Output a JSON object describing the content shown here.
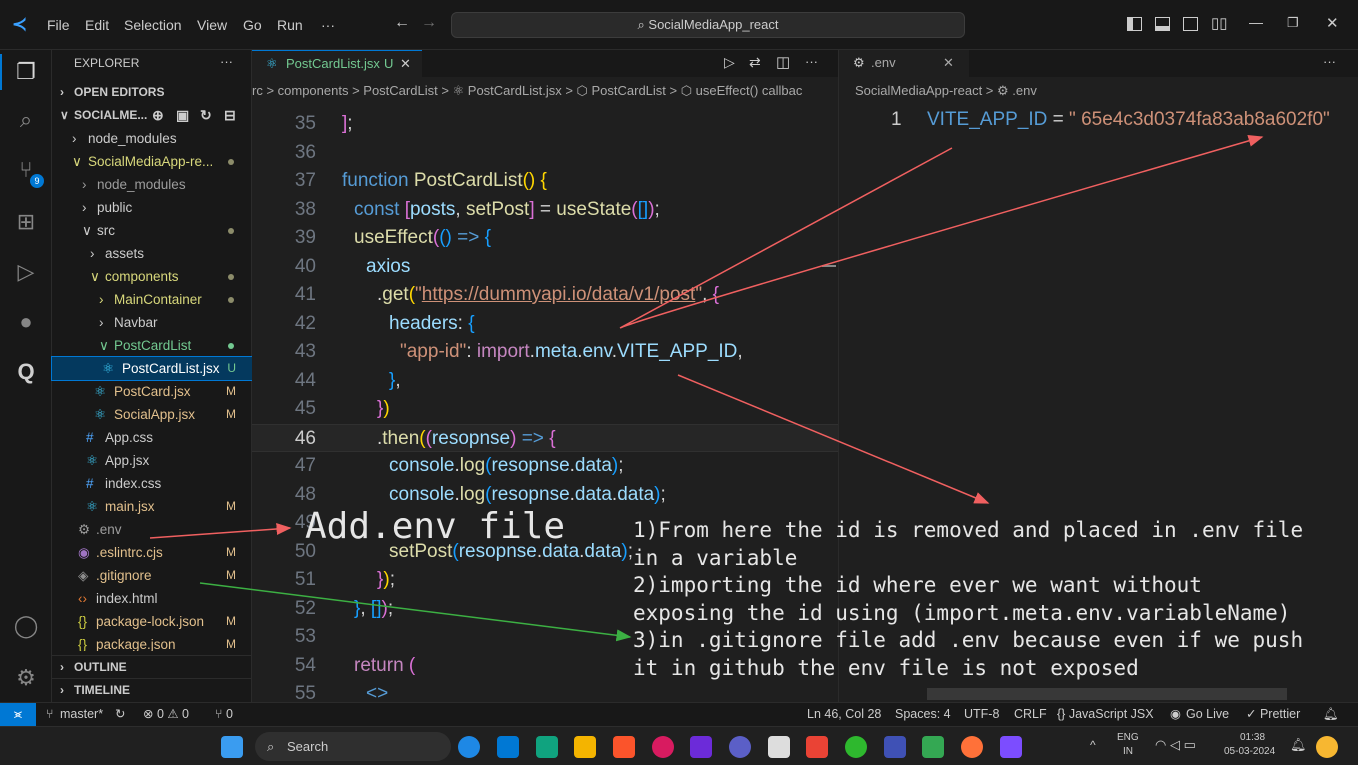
{
  "menu": [
    "File",
    "Edit",
    "Selection",
    "View",
    "Go",
    "Run",
    "···"
  ],
  "search": {
    "text": "SocialMediaApp_react"
  },
  "sidebar": {
    "title": "EXPLORER",
    "more": "···",
    "open_editors": "OPEN EDITORS",
    "root": "SOCIALME...",
    "items": [
      {
        "label": "node_modules",
        "arrow": ">"
      },
      {
        "label": "SocialMediaApp-re...",
        "arrow": "∨"
      },
      {
        "label": "node_modules",
        "arrow": ">"
      },
      {
        "label": "public",
        "arrow": ">"
      },
      {
        "label": "src",
        "arrow": "∨"
      },
      {
        "label": "assets",
        "arrow": ">"
      },
      {
        "label": "components",
        "arrow": "∨"
      },
      {
        "label": "MainContainer",
        "arrow": ">"
      },
      {
        "label": "Navbar",
        "arrow": ">"
      },
      {
        "label": "PostCardList",
        "arrow": "∨"
      },
      {
        "label": "PostCardList.jsx",
        "badge": "U"
      },
      {
        "label": "PostCard.jsx",
        "badge": "M"
      },
      {
        "label": "SocialApp.jsx",
        "badge": "M"
      },
      {
        "label": "App.css"
      },
      {
        "label": "App.jsx"
      },
      {
        "label": "index.css"
      },
      {
        "label": "main.jsx",
        "badge": "M"
      },
      {
        "label": ".env"
      },
      {
        "label": ".eslintrc.cjs",
        "badge": "M"
      },
      {
        "label": ".gitignore",
        "badge": "M"
      },
      {
        "label": "index.html"
      },
      {
        "label": "package-lock.json",
        "badge": "M"
      },
      {
        "label": "package.json",
        "badge": "M"
      }
    ],
    "outline": "OUTLINE",
    "timeline": "TIMELINE"
  },
  "editor_left": {
    "tab": "PostCardList.jsx",
    "tab_badge": "U",
    "breadcrumb": "rc > components > PostCardList > ⚛ PostCardList.jsx > ⬡ PostCardList > ⬡ useEffect() callbac",
    "line_numbers": [
      "35",
      "36",
      "37",
      "38",
      "39",
      "40",
      "41",
      "42",
      "43",
      "44",
      "45",
      "46",
      "47",
      "48",
      "49",
      "50",
      "51",
      "52",
      "53",
      "54",
      "55"
    ]
  },
  "editor_right": {
    "tab": ".env",
    "breadcrumb": "SocialMediaApp-react > ⚙ .env",
    "line_number": "1",
    "env_key": "VITE_APP_ID",
    "env_eq": " = ",
    "env_value": "\" 65e4c3d0374fa83ab8a602f0\""
  },
  "annotations": {
    "add_env": "Add.env file",
    "note1": "1)From here the id is removed and placed in .env file\nin a variable",
    "note2": "2)importing the id where ever we want without\nexposing the id using (import.meta.env.variableName)",
    "note3": "3)in .gitignore file add .env because even if we push\nit in github the env file is not exposed"
  },
  "status": {
    "branch": "master*",
    "problems": "⊗ 0 ⚠ 0",
    "ports": "⑂ 0",
    "position": "Ln 46, Col 28",
    "spaces": "Spaces: 4",
    "encoding": "UTF-8",
    "eol": "CRLF",
    "language": "{} JavaScript JSX",
    "golive": "Go Live",
    "prettier": "✓ Prettier"
  },
  "taskbar": {
    "search": "Search",
    "lang": "ENG",
    "region": "IN",
    "time": "01:38",
    "date": "05-03-2024"
  },
  "colors": {
    "accent": "#0078d4",
    "arrow_red": "#f06060",
    "arrow_green": "#3cb043"
  }
}
